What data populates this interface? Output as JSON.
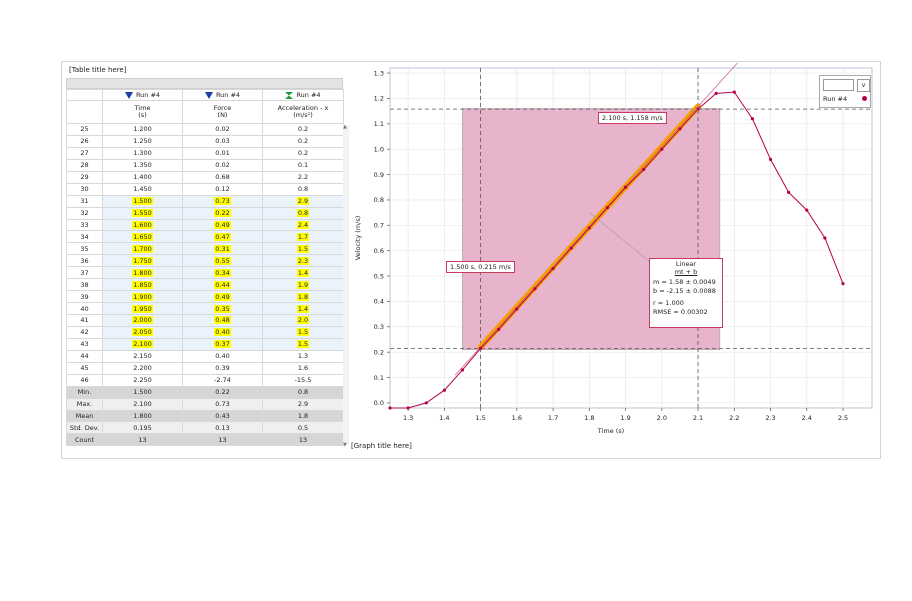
{
  "table": {
    "title": "[Table title here]",
    "columns": [
      {
        "run": "Run #4",
        "icon": "blue-triangle-icon",
        "name": "Time",
        "unit": "(s)"
      },
      {
        "run": "Run #4",
        "icon": "blue-triangle-icon",
        "name": "Force",
        "unit": "(N)"
      },
      {
        "run": "Run #4",
        "icon": "green-hourglass-icon",
        "name": "Acceleration - x",
        "unit": "(m/s²)"
      }
    ],
    "rows": [
      {
        "n": "25",
        "time": "1.200",
        "force": "0.02",
        "acc": "0.2",
        "sel": false
      },
      {
        "n": "26",
        "time": "1.250",
        "force": "0.03",
        "acc": "0.2",
        "sel": false
      },
      {
        "n": "27",
        "time": "1.300",
        "force": "0.01",
        "acc": "0.2",
        "sel": false
      },
      {
        "n": "28",
        "time": "1.350",
        "force": "0.02",
        "acc": "0.1",
        "sel": false
      },
      {
        "n": "29",
        "time": "1.400",
        "force": "0.68",
        "acc": "2.2",
        "sel": false
      },
      {
        "n": "30",
        "time": "1.450",
        "force": "0.12",
        "acc": "0.8",
        "sel": false
      },
      {
        "n": "31",
        "time": "1.500",
        "force": "0.73",
        "acc": "2.9",
        "sel": true
      },
      {
        "n": "32",
        "time": "1.550",
        "force": "0.22",
        "acc": "0.8",
        "sel": true
      },
      {
        "n": "33",
        "time": "1.600",
        "force": "0.49",
        "acc": "2.4",
        "sel": true
      },
      {
        "n": "34",
        "time": "1.650",
        "force": "0.47",
        "acc": "1.7",
        "sel": true
      },
      {
        "n": "35",
        "time": "1.700",
        "force": "0.31",
        "acc": "1.5",
        "sel": true
      },
      {
        "n": "36",
        "time": "1.750",
        "force": "0.55",
        "acc": "2.3",
        "sel": true
      },
      {
        "n": "37",
        "time": "1.800",
        "force": "0.34",
        "acc": "1.4",
        "sel": true
      },
      {
        "n": "38",
        "time": "1.850",
        "force": "0.44",
        "acc": "1.9",
        "sel": true
      },
      {
        "n": "39",
        "time": "1.900",
        "force": "0.49",
        "acc": "1.8",
        "sel": true
      },
      {
        "n": "40",
        "time": "1.950",
        "force": "0.35",
        "acc": "1.4",
        "sel": true
      },
      {
        "n": "41",
        "time": "2.000",
        "force": "0.48",
        "acc": "2.0",
        "sel": true
      },
      {
        "n": "42",
        "time": "2.050",
        "force": "0.40",
        "acc": "1.5",
        "sel": true
      },
      {
        "n": "43",
        "time": "2.100",
        "force": "0.37",
        "acc": "1.5",
        "sel": true
      },
      {
        "n": "44",
        "time": "2.150",
        "force": "0.40",
        "acc": "1.3",
        "sel": false
      },
      {
        "n": "45",
        "time": "2.200",
        "force": "0.39",
        "acc": "1.6",
        "sel": false
      },
      {
        "n": "46",
        "time": "2.250",
        "force": "-2.74",
        "acc": "-15.5",
        "sel": false
      }
    ],
    "stats": [
      {
        "label": "Min.",
        "time": "1.500",
        "force": "0.22",
        "acc": "0.8"
      },
      {
        "label": "Max.",
        "time": "2.100",
        "force": "0.73",
        "acc": "2.9"
      },
      {
        "label": "Mean",
        "time": "1.800",
        "force": "0.43",
        "acc": "1.8"
      },
      {
        "label": "Std. Dev.",
        "time": "0.195",
        "force": "0.13",
        "acc": "0.5"
      },
      {
        "label": "Count",
        "time": "13",
        "force": "13",
        "acc": "13"
      }
    ]
  },
  "graph": {
    "title": "[Graph title here]",
    "legend": {
      "run_label": "Run #4",
      "dropdown": "v",
      "color": "#b7004c"
    },
    "readout_upper": "2.100 s, 1.158 m/s",
    "readout_lower": "1.500 s, 0.215 m/s",
    "fit": {
      "title": "Linear",
      "formula": "mt + b",
      "m": "m = 1.58  ± 0.0049",
      "b": "b  = -2.15 ± 0.0088",
      "r": "r      = 1.000",
      "rmse": "RMSE = 0.00302"
    }
  },
  "chart_data": {
    "type": "line",
    "xlabel": "Time (s)",
    "ylabel": "Velocity (m/s)",
    "xlim": [
      1.25,
      2.58
    ],
    "ylim": [
      -0.02,
      1.32
    ],
    "xticks": [
      1.3,
      1.4,
      1.5,
      1.6,
      1.7,
      1.8,
      1.9,
      2.0,
      2.1,
      2.2,
      2.3,
      2.4,
      2.5
    ],
    "yticks": [
      0.0,
      0.1,
      0.2,
      0.3,
      0.4,
      0.5,
      0.6,
      0.7,
      0.8,
      0.9,
      1.0,
      1.1,
      1.2,
      1.3
    ],
    "grid": true,
    "series": [
      {
        "name": "Run #4",
        "color": "#b7004c",
        "x": [
          1.25,
          1.3,
          1.35,
          1.4,
          1.45,
          1.5,
          1.55,
          1.6,
          1.65,
          1.7,
          1.75,
          1.8,
          1.85,
          1.9,
          1.95,
          2.0,
          2.05,
          2.1,
          2.15,
          2.2,
          2.25,
          2.3,
          2.35,
          2.4,
          2.45,
          2.5
        ],
        "y": [
          -0.02,
          -0.02,
          0.0,
          0.05,
          0.13,
          0.215,
          0.29,
          0.37,
          0.45,
          0.53,
          0.61,
          0.69,
          0.77,
          0.85,
          0.92,
          1.0,
          1.08,
          1.158,
          1.22,
          1.225,
          1.12,
          0.96,
          0.83,
          0.76,
          0.65,
          0.47
        ]
      }
    ],
    "fit_line": {
      "m": 1.58,
      "b": -2.15,
      "x_range": [
        1.5,
        2.1
      ]
    },
    "selection": {
      "x": [
        1.45,
        2.16
      ],
      "y": [
        0.21,
        1.16
      ]
    },
    "cursors": {
      "x": [
        1.5,
        2.1
      ],
      "y": [
        0.215,
        1.158
      ]
    }
  },
  "colors": {
    "selection": "#e8b4cb",
    "fit": "#f5a000",
    "series": "#b7004c",
    "cursor": "#555555"
  }
}
